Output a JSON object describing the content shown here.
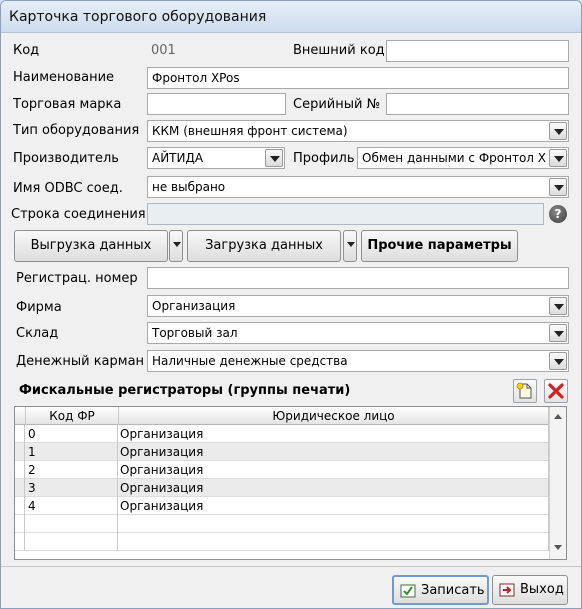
{
  "window": {
    "title": "Карточка торгового оборудования"
  },
  "form": {
    "code_label": "Код",
    "code_value": "001",
    "ext_code_label": "Внешний код",
    "ext_code_value": "",
    "name_label": "Наименование",
    "name_value": "Фронтол XPos",
    "brand_label": "Торговая марка",
    "brand_value": "",
    "serial_label": "Серийный №",
    "serial_value": "",
    "equip_type_label": "Тип оборудования",
    "equip_type_value": "ККМ (внешняя фронт система)",
    "maker_label": "Производитель",
    "maker_value": "АЙТИДА",
    "profile_label": "Профиль",
    "profile_value": "Обмен данными с Фронтол X",
    "odbc_label": "Имя ODBC соед.",
    "odbc_value": "не выбрано",
    "conn_label": "Строка соединения",
    "conn_value": "",
    "help_glyph": "?",
    "reg_label": "Регистрац. номер",
    "reg_value": "",
    "firm_label": "Фирма",
    "firm_value": "Организация",
    "store_label": "Склад",
    "store_value": "Торговый зал",
    "cash_label": "Денежный карман",
    "cash_value": "Наличные денежные средства"
  },
  "buttons": {
    "upload": "Выгрузка данных",
    "download": "Загрузка данных",
    "other": "Прочие параметры"
  },
  "fiscal": {
    "title": "Фискальные регистраторы (группы печати)",
    "columns": [
      "Код ФР",
      "Юридическое лицо"
    ],
    "rows": [
      {
        "code": "0",
        "entity": "Организация"
      },
      {
        "code": "1",
        "entity": "Организация"
      },
      {
        "code": "2",
        "entity": "Организация"
      },
      {
        "code": "3",
        "entity": "Организация"
      },
      {
        "code": "4",
        "entity": "Организация"
      }
    ]
  },
  "footer": {
    "save": "Записать",
    "exit": "Выход"
  },
  "colors": {
    "accent": "#6f9bd1",
    "delete": "#d42020",
    "title_bg": "#cddcee"
  },
  "icons": {
    "add": "add-document-icon",
    "delete": "delete-x-icon",
    "save": "save-icon",
    "exit": "exit-icon",
    "help": "help-icon"
  }
}
